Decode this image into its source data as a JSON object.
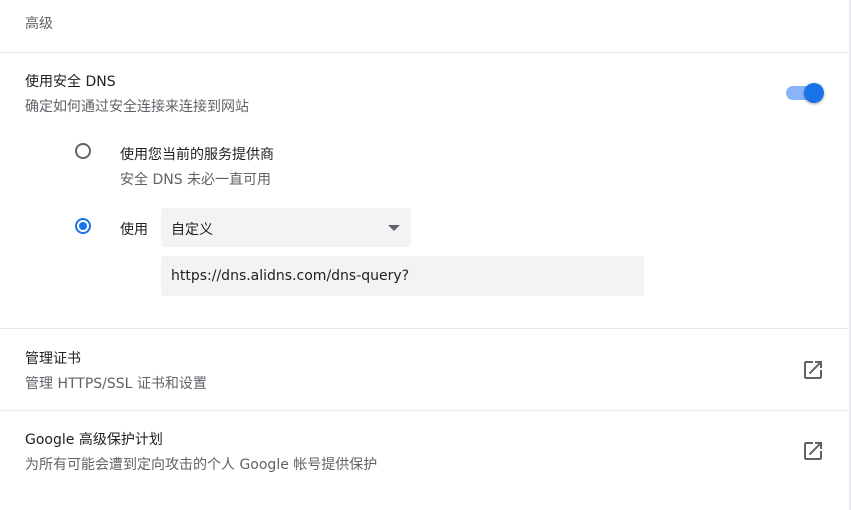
{
  "section": {
    "header": "高级"
  },
  "secure_dns": {
    "title": "使用安全 DNS",
    "subtitle": "确定如何通过安全连接来连接到网站",
    "enabled": true,
    "option_current": {
      "label": "使用您当前的服务提供商",
      "sub": "安全 DNS 未必一直可用",
      "checked": false
    },
    "option_custom": {
      "label": "使用",
      "checked": true,
      "select_value": "自定义",
      "url_value": "https://dns.alidns.com/dns-query?"
    }
  },
  "certificates": {
    "title": "管理证书",
    "subtitle": "管理 HTTPS/SSL 证书和设置",
    "icon": "open-in-new-icon"
  },
  "advanced_protection": {
    "title": "Google 高级保护计划",
    "subtitle": "为所有可能会遭到定向攻击的个人 Google 帐号提供保护",
    "icon": "open-in-new-icon"
  },
  "colors": {
    "accent": "#1a73e8",
    "toggle_track": "#8ab4f8",
    "secondary_text": "#5f6368",
    "field_bg": "#f1f3f4"
  }
}
